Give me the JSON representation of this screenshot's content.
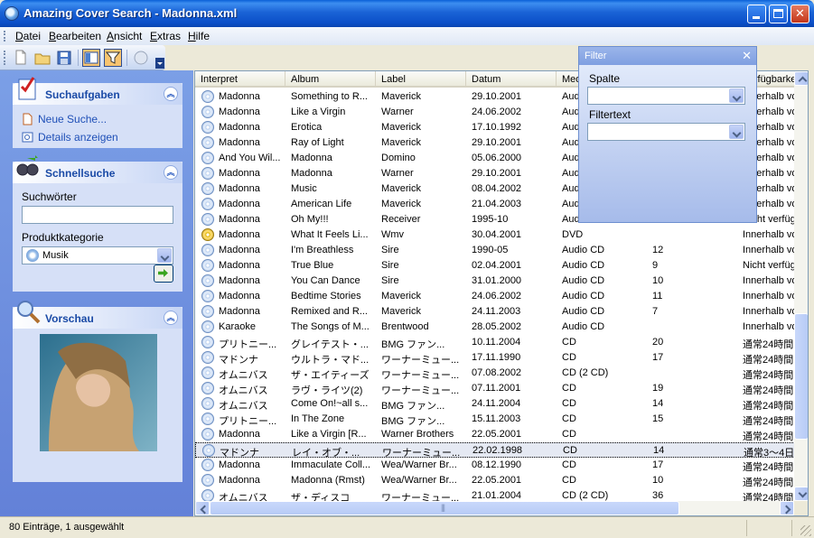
{
  "window": {
    "title": "Amazing Cover Search - Madonna.xml"
  },
  "menu": [
    {
      "u": "D",
      "rest": "atei"
    },
    {
      "u": "B",
      "rest": "earbeiten"
    },
    {
      "u": "A",
      "rest": "nsicht"
    },
    {
      "u": "E",
      "rest": "xtras"
    },
    {
      "u": "H",
      "rest": "ilfe"
    }
  ],
  "sidebar": {
    "tasks": {
      "title": "Suchaufgaben",
      "links": [
        "Neue Suche...",
        "Details anzeigen"
      ]
    },
    "quicksearch": {
      "title": "Schnellsuche",
      "keywords_label": "Suchwörter",
      "keywords_value": "",
      "category_label": "Produktkategorie",
      "category_value": "Musik"
    },
    "preview": {
      "title": "Vorschau"
    }
  },
  "columns": [
    "Interpret",
    "Album",
    "Label",
    "Datum",
    "Medium",
    "",
    "Verfügbarkeit"
  ],
  "rows": [
    {
      "artist": "Madonna",
      "album": "Something to R...",
      "label": "Maverick",
      "date": "29.10.2001",
      "medium": "Audio CD",
      "discs": "",
      "avail": "Innerhalb von",
      "icon": "cd"
    },
    {
      "artist": "Madonna",
      "album": "Like a Virgin",
      "label": "Warner",
      "date": "24.06.2002",
      "medium": "Audio CD",
      "discs": "",
      "avail": "Innerhalb von",
      "icon": "cd"
    },
    {
      "artist": "Madonna",
      "album": "Erotica",
      "label": "Maverick",
      "date": "17.10.1992",
      "medium": "Audio CD",
      "discs": "",
      "avail": "Innerhalb von",
      "icon": "cd"
    },
    {
      "artist": "Madonna",
      "album": "Ray of Light",
      "label": "Maverick",
      "date": "29.10.2001",
      "medium": "Audio CD",
      "discs": "",
      "avail": "Innerhalb von",
      "icon": "cd"
    },
    {
      "artist": "And You Wil...",
      "album": "Madonna",
      "label": "Domino",
      "date": "05.06.2000",
      "medium": "Audio CD",
      "discs": "",
      "avail": "Innerhalb von",
      "icon": "cd"
    },
    {
      "artist": "Madonna",
      "album": "Madonna",
      "label": "Warner",
      "date": "29.10.2001",
      "medium": "Audio CD",
      "discs": "",
      "avail": "Innerhalb von",
      "icon": "cd"
    },
    {
      "artist": "Madonna",
      "album": "Music",
      "label": "Maverick",
      "date": "08.04.2002",
      "medium": "Audio CD",
      "discs": "",
      "avail": "Innerhalb von",
      "icon": "cd"
    },
    {
      "artist": "Madonna",
      "album": "American Life",
      "label": "Maverick",
      "date": "21.04.2003",
      "medium": "Audio CD",
      "discs": "",
      "avail": "Innerhalb von",
      "icon": "cd"
    },
    {
      "artist": "Madonna",
      "album": "Oh My!!!",
      "label": "Receiver",
      "date": "1995-10",
      "medium": "Audio CD",
      "discs": "",
      "avail": "Nicht verfügbar",
      "icon": "cd"
    },
    {
      "artist": "Madonna",
      "album": "What It Feels Li...",
      "label": "Wmv",
      "date": "30.04.2001",
      "medium": "DVD",
      "discs": "",
      "avail": "Innerhalb von",
      "icon": "dvd"
    },
    {
      "artist": "Madonna",
      "album": "I'm Breathless",
      "label": "Sire",
      "date": "1990-05",
      "medium": "Audio CD",
      "discs": "12",
      "avail": "Innerhalb von",
      "icon": "cd"
    },
    {
      "artist": "Madonna",
      "album": "True Blue",
      "label": "Sire",
      "date": "02.04.2001",
      "medium": "Audio CD",
      "discs": "9",
      "avail": "Nicht verfügbar",
      "icon": "cd"
    },
    {
      "artist": "Madonna",
      "album": "You Can Dance",
      "label": "Sire",
      "date": "31.01.2000",
      "medium": "Audio CD",
      "discs": "10",
      "avail": "Innerhalb von",
      "icon": "cd"
    },
    {
      "artist": "Madonna",
      "album": "Bedtime Stories",
      "label": "Maverick",
      "date": "24.06.2002",
      "medium": "Audio CD",
      "discs": "11",
      "avail": "Innerhalb von",
      "icon": "cd"
    },
    {
      "artist": "Madonna",
      "album": "Remixed and R...",
      "label": "Maverick",
      "date": "24.11.2003",
      "medium": "Audio CD",
      "discs": "7",
      "avail": "Innerhalb von",
      "icon": "cd"
    },
    {
      "artist": "Karaoke",
      "album": "The Songs of M...",
      "label": "Brentwood",
      "date": "28.05.2002",
      "medium": "Audio CD",
      "discs": "",
      "avail": "Innerhalb von",
      "icon": "cd"
    },
    {
      "artist": "プリトニー...",
      "album": "グレイテスト・...",
      "label": "BMG ファン...",
      "date": "10.11.2004",
      "medium": "CD",
      "discs": "20",
      "avail": "通常24時間",
      "icon": "cd"
    },
    {
      "artist": "マドンナ",
      "album": "ウルトラ・マド...",
      "label": "ワーナーミュー...",
      "date": "17.11.1990",
      "medium": "CD",
      "discs": "17",
      "avail": "通常24時間",
      "icon": "cd"
    },
    {
      "artist": "オムニバス",
      "album": "ザ・エイティーズ",
      "label": "ワーナーミュー...",
      "date": "07.08.2002",
      "medium": "CD (2 CD)",
      "discs": "",
      "avail": "通常24時間",
      "icon": "cd"
    },
    {
      "artist": "オムニバス",
      "album": "ラヴ・ライツ(2)",
      "label": "ワーナーミュー...",
      "date": "07.11.2001",
      "medium": "CD",
      "discs": "19",
      "avail": "通常24時間",
      "icon": "cd"
    },
    {
      "artist": "オムニバス",
      "album": "Come On!~all s...",
      "label": "BMG ファン...",
      "date": "24.11.2004",
      "medium": "CD",
      "discs": "14",
      "avail": "通常24時間",
      "icon": "cd"
    },
    {
      "artist": "プリトニー...",
      "album": "In The Zone",
      "label": "BMG ファン...",
      "date": "15.11.2003",
      "medium": "CD",
      "discs": "15",
      "avail": "通常24時間",
      "icon": "cd"
    },
    {
      "artist": "Madonna",
      "album": "Like a Virgin [R...",
      "label": "Warner Brothers",
      "date": "22.05.2001",
      "medium": "CD",
      "discs": "",
      "avail": "通常24時間",
      "icon": "cd"
    },
    {
      "artist": "マドンナ",
      "album": "レイ・オブ・...",
      "label": "ワーナーミュー...",
      "date": "22.02.1998",
      "medium": "CD",
      "discs": "14",
      "avail": "通常3～4日",
      "icon": "cd",
      "selected": true
    },
    {
      "artist": "Madonna",
      "album": "Immaculate Coll...",
      "label": "Wea/Warner Br...",
      "date": "08.12.1990",
      "medium": "CD",
      "discs": "17",
      "avail": "通常24時間",
      "icon": "cd"
    },
    {
      "artist": "Madonna",
      "album": "Madonna (Rmst)",
      "label": "Wea/Warner Br...",
      "date": "22.05.2001",
      "medium": "CD",
      "discs": "10",
      "avail": "通常24時間",
      "icon": "cd"
    },
    {
      "artist": "オムニバス",
      "album": "ザ・ディスコ",
      "label": "ワーナーミュー...",
      "date": "21.01.2004",
      "medium": "CD (2 CD)",
      "discs": "36",
      "avail": "通常24時間",
      "icon": "cd"
    }
  ],
  "filter": {
    "title": "Filter",
    "column_label": "Spalte",
    "column_value": "",
    "text_label": "Filtertext",
    "text_value": ""
  },
  "status": {
    "text": "80 Einträge, 1 ausgewählt"
  }
}
